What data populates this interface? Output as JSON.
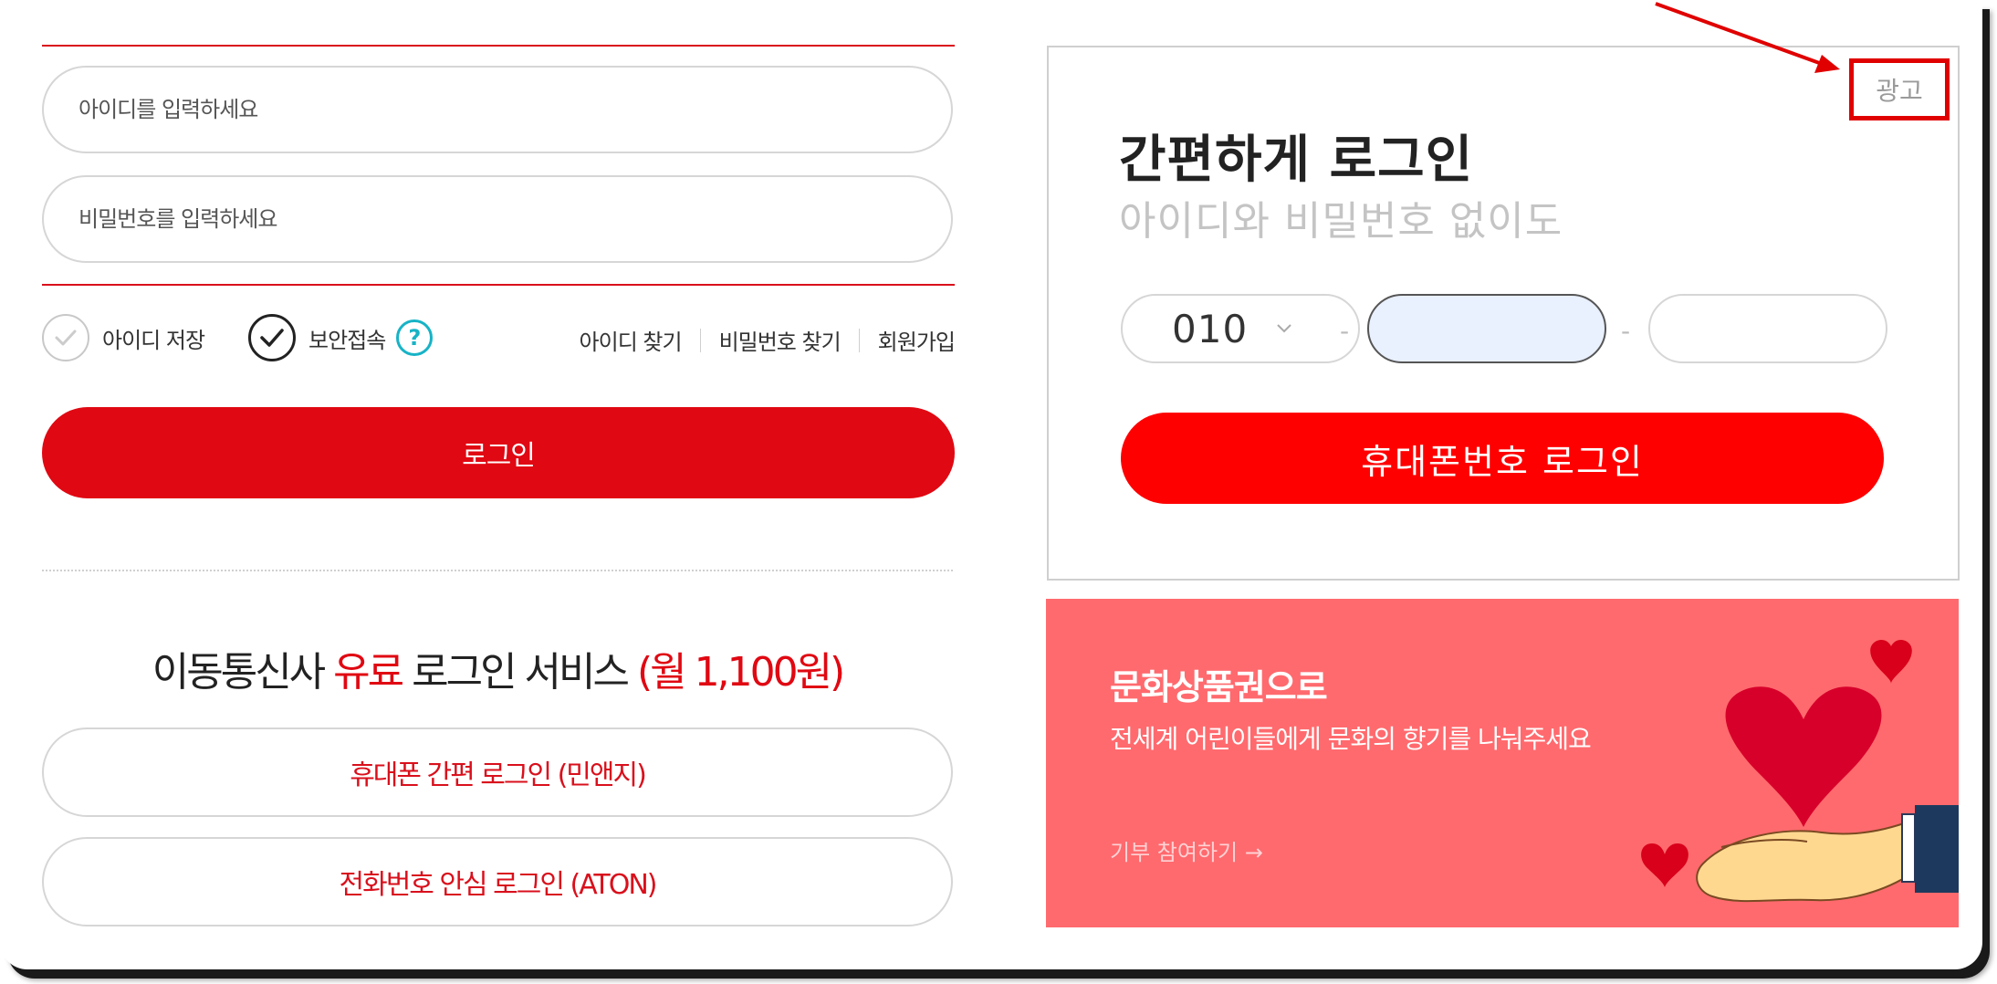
{
  "login": {
    "id_placeholder": "아이디를 입력하세요",
    "pw_placeholder": "비밀번호를 입력하세요",
    "save_id_label": "아이디 저장",
    "secure_label": "보안접속",
    "help_glyph": "?",
    "find_id": "아이디 찾기",
    "find_pw": "비밀번호 찾기",
    "signup": "회원가입",
    "login_button": "로그인"
  },
  "paid": {
    "title_prefix": "이동통신사 ",
    "title_highlight": "유료",
    "title_middle": " 로그인 서비스 ",
    "title_price": "(월 1,100원)",
    "mobile_button": "휴대폰 간편 로그인 (민앤지)",
    "phone_button": "전화번호 안심 로그인 (ATON)"
  },
  "simple": {
    "ad_label": "광고",
    "title": "간편하게 로그인",
    "subtitle": "아이디와 비밀번호 없이도",
    "prefix_value": "010",
    "dash": "-",
    "button": "휴대폰번호 로그인"
  },
  "banner": {
    "title": "문화상품권으로",
    "subtitle": "전세계 어린이들에게 문화의 향기를 나눠주세요",
    "cta": "기부 참여하기 →"
  },
  "colors": {
    "brand_red": "#e00812",
    "button_red": "#ff0000",
    "banner_bg": "#ff6a6e",
    "help_teal": "#17b3c6",
    "annotation_red": "#e00000"
  }
}
